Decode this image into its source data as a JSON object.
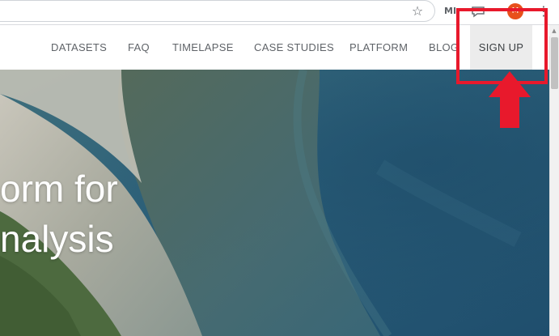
{
  "browser": {
    "ext_icon": "MI",
    "avatar_initial": "M",
    "star_icon": "star-icon",
    "menu_icon": "kebab-icon"
  },
  "nav": {
    "items": [
      "DATASETS",
      "FAQ",
      "TIMELAPSE",
      "CASE STUDIES",
      "PLATFORM",
      "BLOG"
    ],
    "signup_label": "SIGN UP"
  },
  "hero": {
    "line1": "orm for",
    "line2": "nalysis"
  },
  "colors": {
    "annotation_red": "#e8192c",
    "avatar_orange": "#e8501c",
    "nav_text": "#5f6368"
  }
}
